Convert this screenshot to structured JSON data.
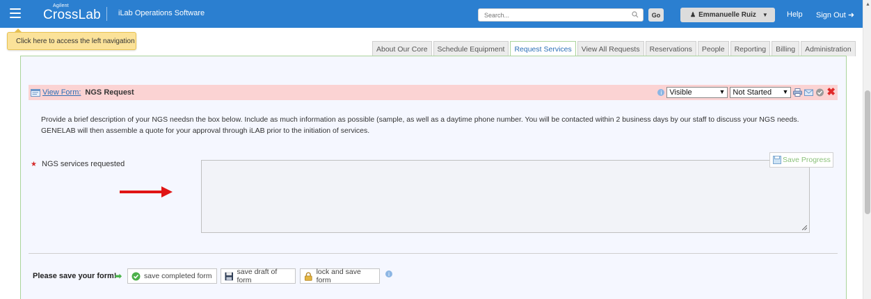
{
  "header": {
    "logo_small": "Agilent",
    "logo_main": "CrossLab",
    "product": "iLab Operations Software",
    "search_placeholder": "Search...",
    "go_label": "Go",
    "user_name": "Emmanuelle Ruiz",
    "help_label": "Help",
    "signout_label": "Sign Out",
    "bar_color": "#2b7fd0"
  },
  "tooltip": {
    "text": "Click here to access the left navigation"
  },
  "tabs": [
    {
      "label": "About Our Core",
      "active": false
    },
    {
      "label": "Schedule Equipment",
      "active": false
    },
    {
      "label": "Request Services",
      "active": true
    },
    {
      "label": "View All Requests",
      "active": false
    },
    {
      "label": "Reservations",
      "active": false
    },
    {
      "label": "People",
      "active": false
    },
    {
      "label": "Reporting",
      "active": false
    },
    {
      "label": "Billing",
      "active": false
    },
    {
      "label": "Administration",
      "active": false
    }
  ],
  "form": {
    "view_form_label": "View Form:",
    "form_name": "NGS Request",
    "visibility_value": "Visible",
    "status_value": "Not Started",
    "header_color": "#fbd3d3",
    "description": "Provide a brief description of your NGS needsn the box below. Include as much information as possible (sample, as well as a daytime phone number. You will be contacted within 2 business days by our staff to discuss your NGS needs. GENELAB will then assemble a quote for your approval through iLAB prior to the initiation of services.",
    "field_label": "NGS services requested",
    "field_value": "",
    "save_progress_label": "Save Progress"
  },
  "footer": {
    "please_save_label": "Please save your form!",
    "save_completed_label": "save completed form",
    "save_draft_label": "save draft of form",
    "lock_save_label": "lock and save form"
  }
}
